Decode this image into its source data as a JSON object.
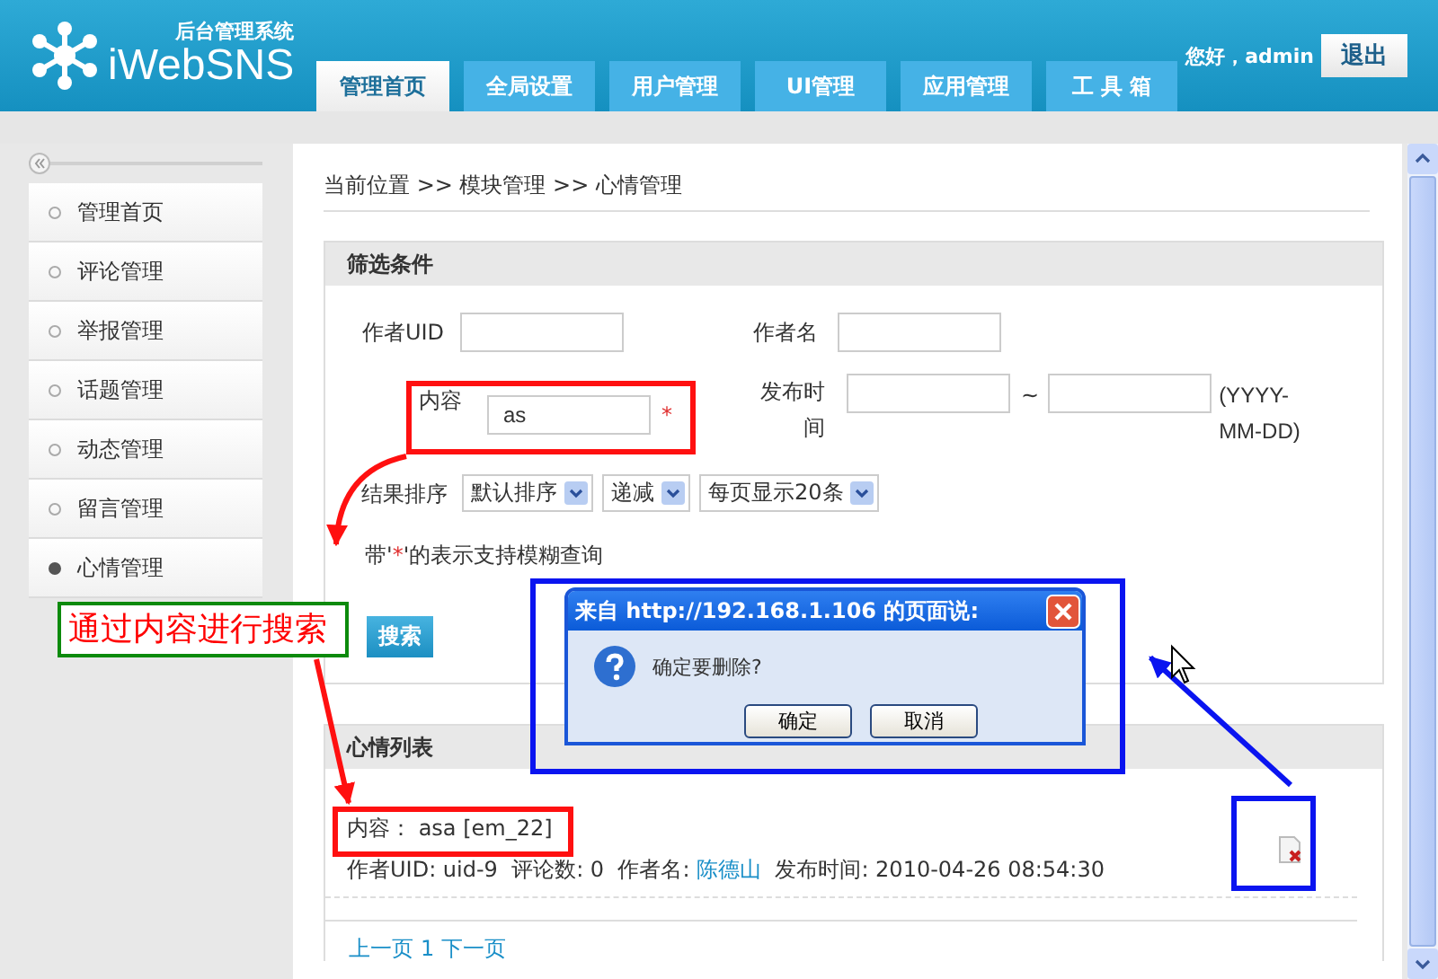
{
  "header": {
    "logo_subtitle": "后台管理系统",
    "logo_title": "iWebSNS",
    "tabs": [
      {
        "label": "管理首页",
        "selected": true
      },
      {
        "label": "全局设置",
        "selected": false
      },
      {
        "label": "用户管理",
        "selected": false
      },
      {
        "label": "UI管理",
        "selected": false
      },
      {
        "label": "应用管理",
        "selected": false
      },
      {
        "label": "工 具 箱",
        "selected": false
      }
    ],
    "greeting": "您好，admin",
    "logout": "退出"
  },
  "sidebar": {
    "items": [
      {
        "label": "管理首页",
        "selected": false
      },
      {
        "label": "评论管理",
        "selected": false
      },
      {
        "label": "举报管理",
        "selected": false
      },
      {
        "label": "话题管理",
        "selected": false
      },
      {
        "label": "动态管理",
        "selected": false
      },
      {
        "label": "留言管理",
        "selected": false
      },
      {
        "label": "心情管理",
        "selected": true
      }
    ]
  },
  "breadcrumb": "当前位置 >> 模块管理 >> 心情管理",
  "filter": {
    "title": "筛选条件",
    "author_uid": {
      "label": "作者UID"
    },
    "author_name": {
      "label": "作者名"
    },
    "content": {
      "label": "内容",
      "value": "as",
      "fuzzy_mark": "*"
    },
    "publish_time": {
      "label": "发布时间",
      "separator": "~",
      "format_hint": "(YYYY-MM-DD)"
    },
    "sort": {
      "label": "结果排序",
      "selects": [
        "默认排序",
        "递减",
        "每页显示20条"
      ]
    },
    "hint": {
      "before": "带'",
      "mark": "*",
      "after": "'的表示支持模糊查询"
    },
    "search_button": "搜索"
  },
  "list": {
    "title": "心情列表",
    "entries": [
      {
        "content_label": "内容：",
        "content": "asa [em_22]",
        "meta_before": "作者UID: uid-9  评论数: 0  作者名: ",
        "author": "陈德山",
        "meta_after": "发布时间: 2010-04-26 08:54:30"
      }
    ],
    "pager": [
      "上一页",
      "1",
      "下一页"
    ]
  },
  "dialog": {
    "title": "来自 http://192.168.1.106 的页面说:",
    "message": "确定要删除?",
    "buttons": [
      "确定",
      "取消"
    ]
  },
  "annotation": {
    "callout": "通过内容进行搜索"
  }
}
